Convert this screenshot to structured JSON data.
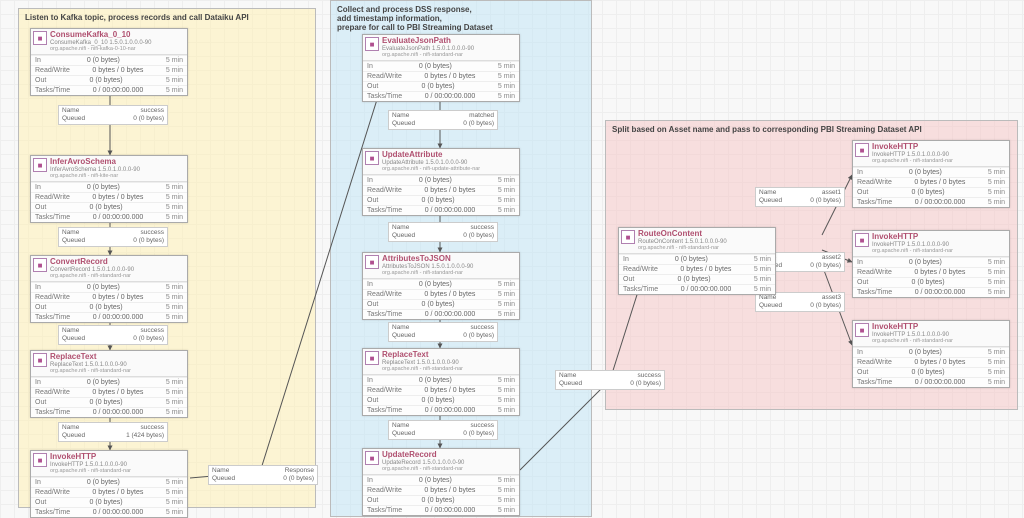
{
  "groups": {
    "yellow": {
      "title": "Listen to Kafka topic, process records and call Dataiku API"
    },
    "blue": {
      "title": "Collect and process DSS response,\nadd timestamp information,\nprepare for call to PBI Streaming Dataset"
    },
    "pink": {
      "title": "Split based on Asset name and pass to corresponding PBI Streaming Dataset API"
    }
  },
  "stats_default": {
    "in": {
      "label": "In",
      "value": "0 (0 bytes)",
      "time": "5 min"
    },
    "rw": {
      "label": "Read/Write",
      "value": "0 bytes / 0 bytes",
      "time": "5 min"
    },
    "out": {
      "label": "Out",
      "value": "0 (0 bytes)",
      "time": "5 min"
    },
    "tasks": {
      "label": "Tasks/Time",
      "value": "0 / 00:00:00.000",
      "time": "5 min"
    }
  },
  "procs": {
    "consume_kafka": {
      "name": "ConsumeKafka_0_10",
      "type": "ConsumeKafka_0_10 1.5.0.1.0.0.0-90",
      "bundle": "org.apache.nifi - nifi-kafka-0-10-nar"
    },
    "infer_avro": {
      "name": "InferAvroSchema",
      "type": "InferAvroSchema 1.5.0.1.0.0.0-90",
      "bundle": "org.apache.nifi - nifi-kite-nar"
    },
    "convert_record": {
      "name": "ConvertRecord",
      "type": "ConvertRecord 1.5.0.1.0.0.0-90",
      "bundle": "org.apache.nifi - nifi-standard-nar"
    },
    "replace_text_a": {
      "name": "ReplaceText",
      "type": "ReplaceText 1.5.0.1.0.0.0-90",
      "bundle": "org.apache.nifi - nifi-standard-nar"
    },
    "invoke_http_a": {
      "name": "InvokeHTTP",
      "type": "InvokeHTTP 1.5.0.1.0.0.0-90",
      "bundle": "org.apache.nifi - nifi-standard-nar"
    },
    "eval_json": {
      "name": "EvaluateJsonPath",
      "type": "EvaluateJsonPath 1.5.0.1.0.0.0-90",
      "bundle": "org.apache.nifi - nifi-standard-nar"
    },
    "update_attr": {
      "name": "UpdateAttribute",
      "type": "UpdateAttribute 1.5.0.1.0.0.0-90",
      "bundle": "org.apache.nifi - nifi-update-attribute-nar"
    },
    "attr_to_json": {
      "name": "AttributesToJSON",
      "type": "AttributesToJSON 1.5.0.1.0.0.0-90",
      "bundle": "org.apache.nifi - nifi-standard-nar"
    },
    "replace_text_b": {
      "name": "ReplaceText",
      "type": "ReplaceText 1.5.0.1.0.0.0-90",
      "bundle": "org.apache.nifi - nifi-standard-nar"
    },
    "update_record": {
      "name": "UpdateRecord",
      "type": "UpdateRecord 1.5.0.1.0.0.0-90",
      "bundle": "org.apache.nifi - nifi-standard-nar"
    },
    "route_content": {
      "name": "RouteOnContent",
      "type": "RouteOnContent 1.5.0.1.0.0.0-90",
      "bundle": "org.apache.nifi - nifi-standard-nar"
    },
    "invoke_http_1": {
      "name": "InvokeHTTP",
      "type": "InvokeHTTP 1.5.0.1.0.0.0-90",
      "bundle": "org.apache.nifi - nifi-standard-nar"
    },
    "invoke_http_2": {
      "name": "InvokeHTTP",
      "type": "InvokeHTTP 1.5.0.1.0.0.0-90",
      "bundle": "org.apache.nifi - nifi-standard-nar"
    },
    "invoke_http_3": {
      "name": "InvokeHTTP",
      "type": "InvokeHTTP 1.5.0.1.0.0.0-90",
      "bundle": "org.apache.nifi - nifi-standard-nar"
    }
  },
  "conns": {
    "success": {
      "name_label": "Name",
      "name_value": "success",
      "queue_label": "Queued",
      "queue_value": "0 (0 bytes)"
    },
    "success_424": {
      "name_label": "Name",
      "name_value": "success",
      "queue_label": "Queued",
      "queue_value": "1 (424 bytes)"
    },
    "matched": {
      "name_label": "Name",
      "name_value": "matched",
      "queue_label": "Queued",
      "queue_value": "0 (0 bytes)"
    },
    "response": {
      "name_label": "Name",
      "name_value": "Response",
      "queue_label": "Queued",
      "queue_value": "0 (0 bytes)"
    },
    "asset1": {
      "name_label": "Name",
      "name_value": "asset1",
      "queue_label": "Queued",
      "queue_value": "0 (0 bytes)"
    },
    "asset2": {
      "name_label": "Name",
      "name_value": "asset2",
      "queue_label": "Queued",
      "queue_value": "0 (0 bytes)"
    },
    "asset3": {
      "name_label": "Name",
      "name_value": "asset3",
      "queue_label": "Queued",
      "queue_value": "0 (0 bytes)"
    }
  }
}
